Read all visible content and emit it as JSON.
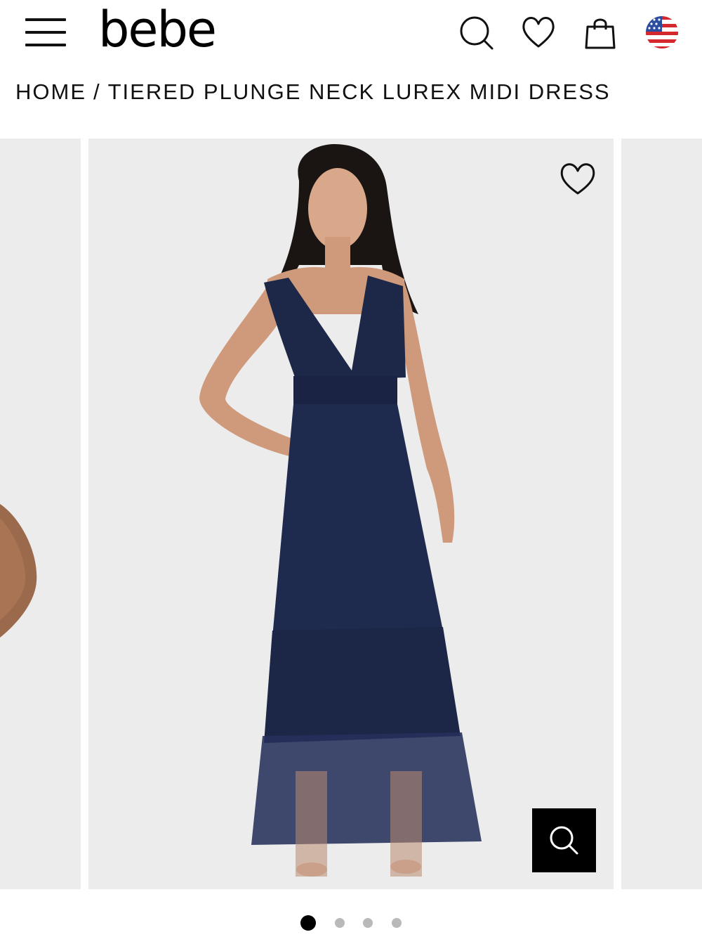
{
  "header": {
    "logo_text": "bebe",
    "icons": [
      "menu-icon",
      "search-icon",
      "heart-icon",
      "shopping-bag-icon",
      "us-flag-icon"
    ]
  },
  "breadcrumb": {
    "home": "HOME",
    "separator": "/",
    "current": "TIERED PLUNGE NECK LUREX MIDI DRESS"
  },
  "carousel": {
    "slide_count": 4,
    "active_index": 0,
    "main_image": "model wearing navy tiered plunge neck lurex dress",
    "prev_image": "partial model image",
    "icons": [
      "heart-icon",
      "zoom-search-icon"
    ]
  },
  "colors": {
    "background": "#ffffff",
    "slide_background": "#ececec",
    "dress": "#1d2747",
    "text": "#111111",
    "dot_active": "#000000",
    "dot_inactive": "#b9b9b9"
  }
}
